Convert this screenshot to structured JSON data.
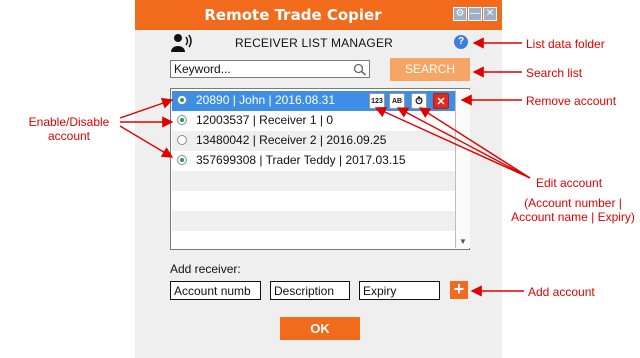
{
  "window": {
    "title": "Remote Trade Copier",
    "controls": [
      "settings-icon",
      "minimize-icon",
      "close-icon"
    ]
  },
  "header": {
    "icon": "receiver-person-icon",
    "title": "RECEIVER LIST MANAGER",
    "help_icon": "help-icon"
  },
  "search": {
    "value": "Keyword...",
    "button_label": "SEARCH"
  },
  "receivers": [
    {
      "text": "20890 | John | 2016.08.31",
      "enabled": true,
      "selected": true
    },
    {
      "text": "12003537 | Receiver 1 | 0",
      "enabled": true,
      "selected": false
    },
    {
      "text": "13480042 | Receiver 2 | 2016.09.25",
      "enabled": false,
      "selected": false
    },
    {
      "text": "357699308 | Trader Teddy | 2017.03.15",
      "enabled": true,
      "selected": false
    }
  ],
  "row_actions": {
    "number_label": "123",
    "name_label": "AB",
    "expiry_icon": "clock-icon",
    "remove_icon": "remove-icon"
  },
  "add_receiver": {
    "label": "Add receiver:",
    "account_value": "Account numb",
    "description_value": "Description",
    "expiry_value": "Expiry",
    "add_icon": "plus-icon"
  },
  "ok_label": "OK",
  "annotations": {
    "list_data_folder": "List data folder",
    "search_list": "Search list",
    "remove_account": "Remove account",
    "enable_disable": "Enable/Disable account",
    "edit_account": "Edit account",
    "edit_details": "(Account number | Account name | Expiry)",
    "add_account": "Add account"
  },
  "colors": {
    "accent": "#f26a1b",
    "selection": "#3e8ee6",
    "annotation": "#e00000",
    "enabled": "#1aa542"
  }
}
